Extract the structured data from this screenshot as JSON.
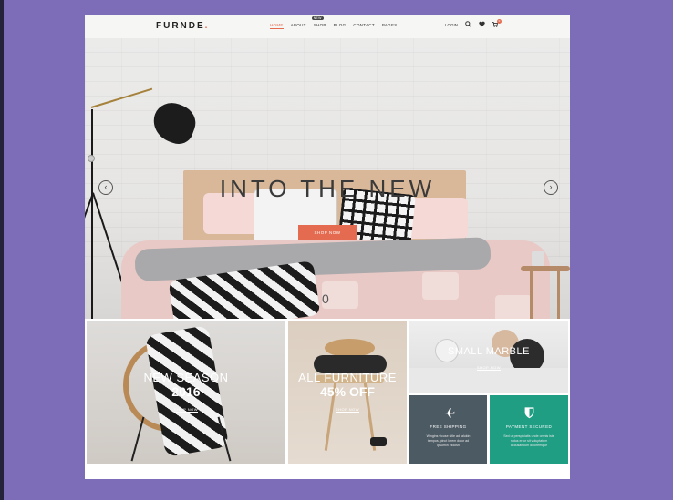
{
  "brand": {
    "logo": "FURNDE",
    "logo_dot": ".",
    "accent": "#e46b4f"
  },
  "nav": {
    "items": [
      "HOME",
      "ABOUT",
      "SHOP",
      "BLOG",
      "CONTACT",
      "PAGES"
    ],
    "active_index": 0,
    "shop_badge": "NEW"
  },
  "header_right": {
    "login": "LOGIN",
    "search_icon": "search-icon",
    "wishlist_icon": "heart-icon",
    "cart_icon": "cart-icon",
    "cart_count": "0"
  },
  "hero": {
    "title": "INTO THE NEW",
    "button": "SHOP NOW",
    "slide_indicator": "0",
    "prev_icon": "chevron-left-icon",
    "next_icon": "chevron-right-icon"
  },
  "banners": [
    {
      "line1": "NEW SEASON",
      "line2": "2016",
      "link": "SHOP NOW"
    },
    {
      "line1": "ALL FURNITURE",
      "line2": "45% OFF",
      "link": "SHOP NOW"
    },
    {
      "line1": "SMALL MARBLE",
      "link": "SHOP NOW"
    }
  ],
  "features": [
    {
      "icon": "airplane-icon",
      "title": "FREE SHIPPING",
      "desc": "Wingins vicuse sitle ad talukin tempos, pinct lorem dolor ad Ipsumin eioclsn",
      "color": "#4c5a63"
    },
    {
      "icon": "shield-icon",
      "title": "PAYMENT SECURED",
      "desc": "Sed ut perspiciatis unde omnis iste natus error sit voluptatem accusantium doloremque",
      "color": "#1f9e84"
    }
  ]
}
